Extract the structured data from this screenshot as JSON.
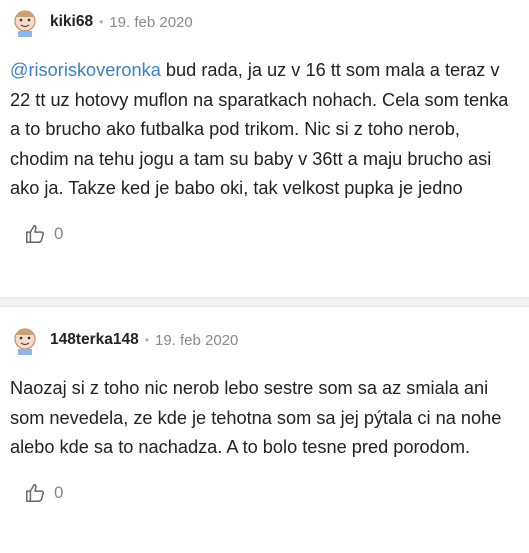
{
  "comments": [
    {
      "username": "kiki68",
      "separator": "•",
      "date": "19. feb 2020",
      "mention": "@risoriskoveronka",
      "text": " bud rada, ja uz v 16 tt som mala a teraz v 22 tt uz hotovy muflon na sparatkach nohach. Cela som tenka a to brucho ako futbalka pod trikom. Nic si z toho nerob, chodim na tehu jogu a tam su baby v 36tt a maju brucho asi ako ja. Takze ked je babo oki, tak velkost pupka je jedno",
      "likes": "0"
    },
    {
      "username": "148terka148",
      "separator": "•",
      "date": "19. feb 2020",
      "text": "Naozaj si z toho nic nerob lebo sestre som sa az smiala ani som nevedela, ze kde je tehotna som sa jej pýtala ci na nohe alebo kde sa to nachadza. A to bolo tesne pred porodom.",
      "likes": "0"
    }
  ],
  "colors": {
    "mention": "#3f7fbf",
    "meta": "#8a8a8a",
    "divider": "#f2f2f2"
  },
  "icons": {
    "avatar": "baby-avatar-icon",
    "like": "thumbs-up-icon"
  }
}
